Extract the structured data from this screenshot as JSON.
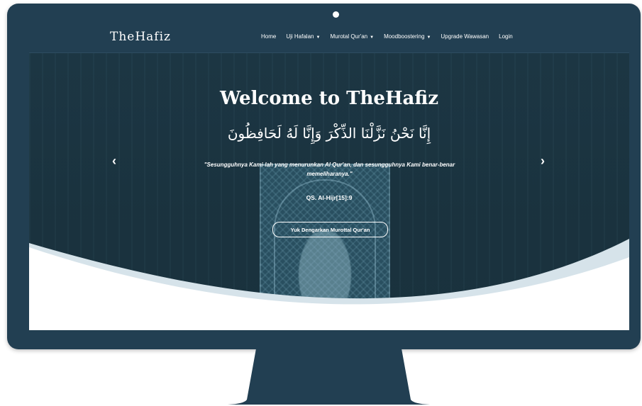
{
  "navbar": {
    "brand": "TheHafiz",
    "items": [
      {
        "label": "Home",
        "has_dropdown": false
      },
      {
        "label": "Uji Hafalan",
        "has_dropdown": true
      },
      {
        "label": "Murotal Qur'an",
        "has_dropdown": true
      },
      {
        "label": "Moodboostering",
        "has_dropdown": true
      },
      {
        "label": "Upgrade Wawasan",
        "has_dropdown": false
      },
      {
        "label": "Login",
        "has_dropdown": false
      }
    ]
  },
  "hero": {
    "title": "Welcome to TheHafiz",
    "arabic_verse": "إِنَّا نَحْنُ نَزَّلْنَا الذِّكْرَ وَإِنَّا لَهُ لَحَافِظُونَ",
    "translation": "\"Sesungguhnya Kami-lah yang menurunkan Al Qur'an, dan sesungguhnya Kami benar-benar memeliharanya.\"",
    "citation": "QS. Al-Hijr[15]:9",
    "cta_label": "Yuk Dengarkan Murottal Qur'an",
    "prev_icon": "chevron-left-icon",
    "next_icon": "chevron-right-icon"
  },
  "colors": {
    "frame": "#223f52",
    "hero_bg": "#1c3746",
    "wave_light": "#d6e3ea",
    "text": "#ffffff"
  }
}
